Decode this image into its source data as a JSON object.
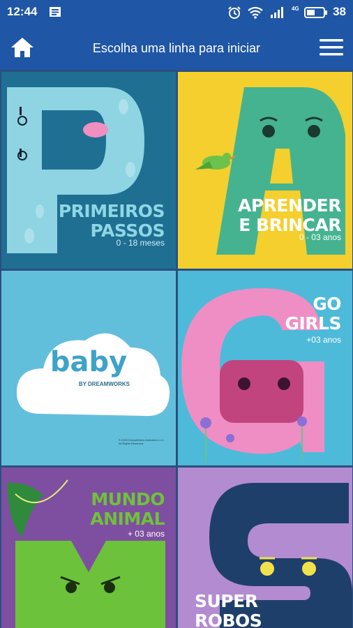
{
  "status_bar": {
    "time": "12:44",
    "network": "4G",
    "battery": "38",
    "icons": [
      "notification-icon",
      "alarm-icon",
      "wifi-icon",
      "signal-icon",
      "battery-icon"
    ]
  },
  "app_bar": {
    "title": "Escolha uma linha para iniciar",
    "home_icon": "home-icon",
    "menu_icon": "hamburger-menu-icon"
  },
  "tiles": [
    {
      "label_line1": "PRIMEIROS",
      "label_line2": "PASSOS",
      "age": "0 - 18 meses",
      "bg": "#1f6f93",
      "label_color": "#8fd6e4"
    },
    {
      "label_line1": "APRENDER",
      "label_line2": "E BRINCAR",
      "age": "0 - 03 anos",
      "bg": "#f4cf2d",
      "label_color": "#ffffff"
    },
    {
      "brand": "baby",
      "brand_sub": "BY DREAMWORKS",
      "copyright": "© 2020 DreamWorks Animation LLC. All Rights Reserved.",
      "bg": "#62bfdc"
    },
    {
      "label_line1": "GO",
      "label_line2": "GIRLS",
      "age": "+03 anos",
      "bg": "#4ebad9",
      "label_color": "#ffffff"
    },
    {
      "label_line1": "MUNDO",
      "label_line2": "ANIMAL",
      "age": "+ 03 anos",
      "bg": "#7e4fa0",
      "label_color": "#6fc23a"
    },
    {
      "label_line1": "SUPER",
      "label_line2": "ROBOS",
      "bg": "#b38bd0",
      "label_color": "#ffffff"
    }
  ]
}
